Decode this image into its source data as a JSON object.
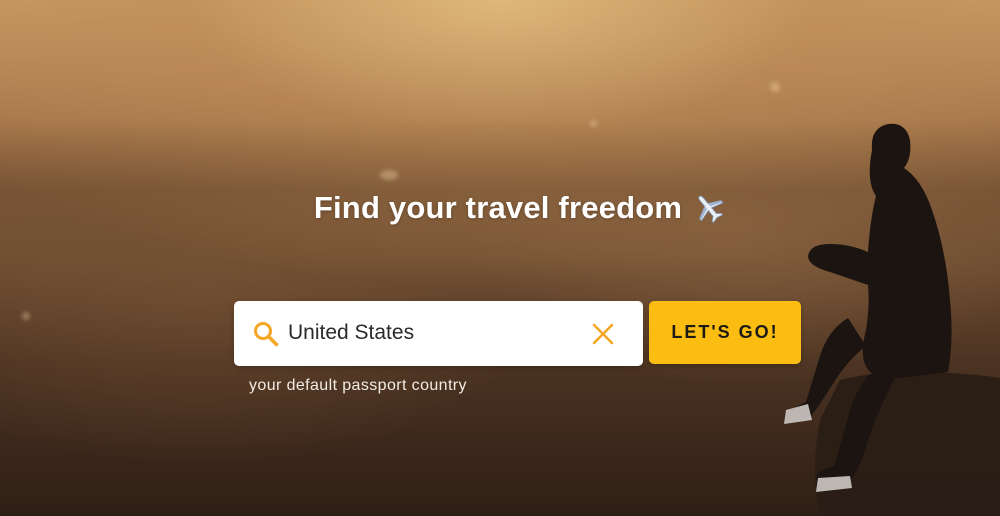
{
  "hero": {
    "headline": "Find your travel freedom",
    "headline_icon": "airplane-icon"
  },
  "search": {
    "icon": "search-icon",
    "value": "United States",
    "clear_icon": "close-icon",
    "helper_text": "your default passport country"
  },
  "cta": {
    "label": "LET'S GO!"
  },
  "colors": {
    "accent": "#fbbd12",
    "icon_orange": "#f5a623",
    "headline_text": "#ffffff"
  }
}
